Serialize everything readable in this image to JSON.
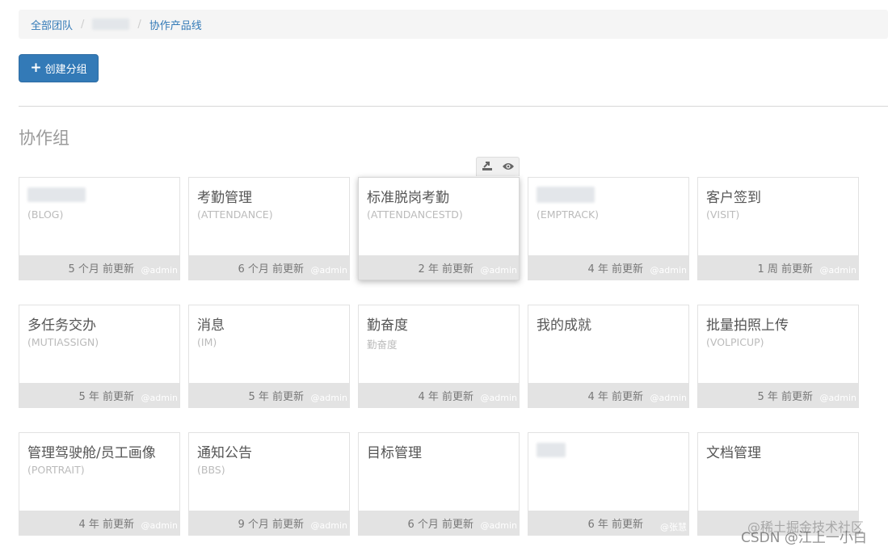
{
  "breadcrumb": {
    "root": "全部团队",
    "sep1": "/",
    "sep2": "/",
    "current": "协作产品线"
  },
  "toolbar": {
    "create_group_label": "创建分组"
  },
  "section": {
    "title": "协作组"
  },
  "cards": [
    {
      "title": "",
      "code": "(BLOG)",
      "updated": "5 个月 前更新",
      "author": "@admin"
    },
    {
      "title": "考勤管理",
      "code": "(ATTENDANCE)",
      "updated": "6 个月 前更新",
      "author": "@admin"
    },
    {
      "title": "标准脱岗考勤",
      "code": "(ATTENDANCESTD)",
      "updated": "2 年 前更新",
      "author": "@admin"
    },
    {
      "title": "",
      "code": "(EMPTRACK)",
      "updated": "4 年 前更新",
      "author": "@admin"
    },
    {
      "title": "客户签到",
      "code": "(VISIT)",
      "updated": "1 周 前更新",
      "author": "@admin"
    },
    {
      "title": "多任务交办",
      "code": "(MUTIASSIGN)",
      "updated": "5 年 前更新",
      "author": "@admin"
    },
    {
      "title": "消息",
      "code": "(IM)",
      "updated": "5 年 前更新",
      "author": "@admin"
    },
    {
      "title": "勤奋度",
      "code": "勤奋度",
      "updated": "4 年 前更新",
      "author": "@admin"
    },
    {
      "title": "我的成就",
      "code": "",
      "updated": "4 年 前更新",
      "author": "@admin"
    },
    {
      "title": "批量拍照上传",
      "code": "(VOLPICUP)",
      "updated": "5 年 前更新",
      "author": "@admin"
    },
    {
      "title": "管理驾驶舱/员工画像",
      "code": "(PORTRAIT)",
      "updated": "4 年 前更新",
      "author": "@admin"
    },
    {
      "title": "通知公告",
      "code": "(BBS)",
      "updated": "9 个月 前更新",
      "author": "@admin"
    },
    {
      "title": "目标管理",
      "code": "",
      "updated": "6 个月 前更新",
      "author": "@admin"
    },
    {
      "title": "",
      "code": "",
      "updated": "6 年 前更新",
      "author": "@张慧"
    },
    {
      "title": "文档管理",
      "code": "",
      "updated": "",
      "author": ""
    }
  ],
  "watermark": {
    "line1": "@稀土掘金技术社区",
    "line2": "CSDN @江上一小白"
  },
  "colors": {
    "primary": "#337ab7",
    "link": "#337ab7",
    "footer_bg": "#e3e3e3"
  },
  "icons": {
    "create": "plus-icon",
    "export": "export-icon",
    "view": "eye-icon"
  }
}
